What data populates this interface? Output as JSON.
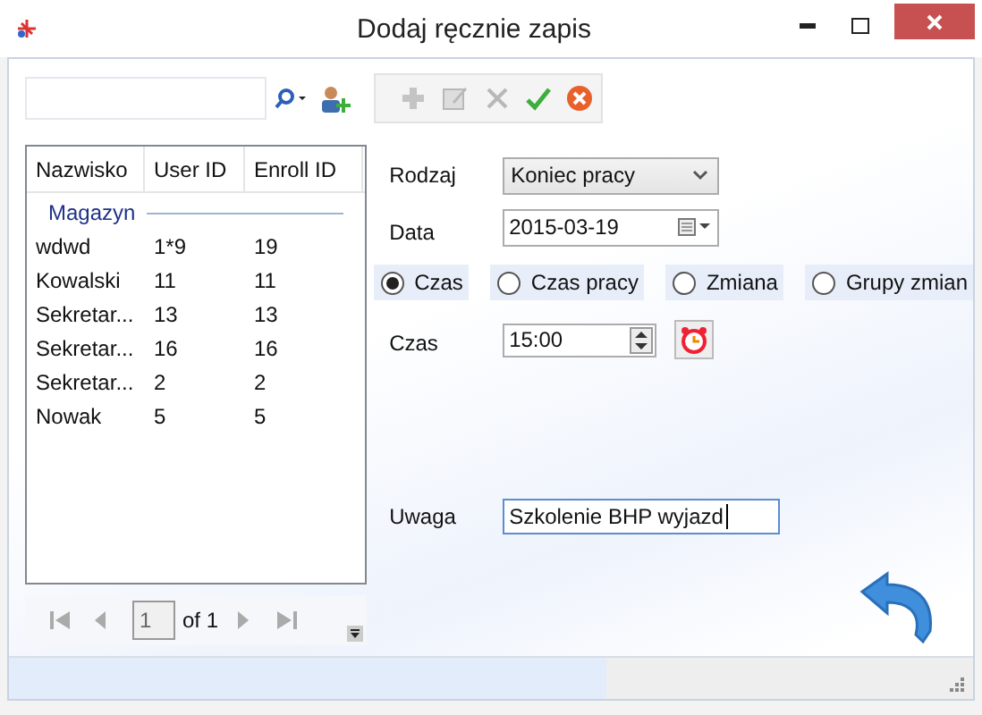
{
  "window": {
    "title": "Dodaj ręcznie zapis"
  },
  "toolbar": [
    {
      "kind": "add",
      "disabled": true
    },
    {
      "kind": "edit",
      "disabled": true
    },
    {
      "kind": "delete",
      "disabled": true
    },
    {
      "kind": "confirm",
      "disabled": false
    },
    {
      "kind": "cancel",
      "disabled": false
    }
  ],
  "table": {
    "columns": [
      "Nazwisko",
      "User ID",
      "Enroll ID"
    ],
    "group": "Magazyn",
    "rows": [
      [
        "wdwd",
        "1*9",
        "19"
      ],
      [
        "Kowalski",
        "11",
        "11"
      ],
      [
        "Sekretar...",
        "13",
        "13"
      ],
      [
        "Sekretar...",
        "16",
        "16"
      ],
      [
        "Sekretar...",
        "2",
        "2"
      ],
      [
        "Nowak",
        "5",
        "5"
      ]
    ]
  },
  "pager": {
    "page": "1",
    "total": "of 1"
  },
  "form": {
    "rodzaj": {
      "label": "Rodzaj",
      "value": "Koniec pracy"
    },
    "data": {
      "label": "Data",
      "value": "2015-03-19"
    },
    "radios": [
      {
        "label": "Czas",
        "selected": true
      },
      {
        "label": "Czas pracy",
        "selected": false
      },
      {
        "label": "Zmiana",
        "selected": false
      },
      {
        "label": "Grupy zmian",
        "selected": false
      }
    ],
    "czas": {
      "label": "Czas",
      "value": "15:00"
    },
    "uwaga": {
      "label": "Uwaga",
      "value": "Szkolenie BHP wyjazd"
    }
  }
}
